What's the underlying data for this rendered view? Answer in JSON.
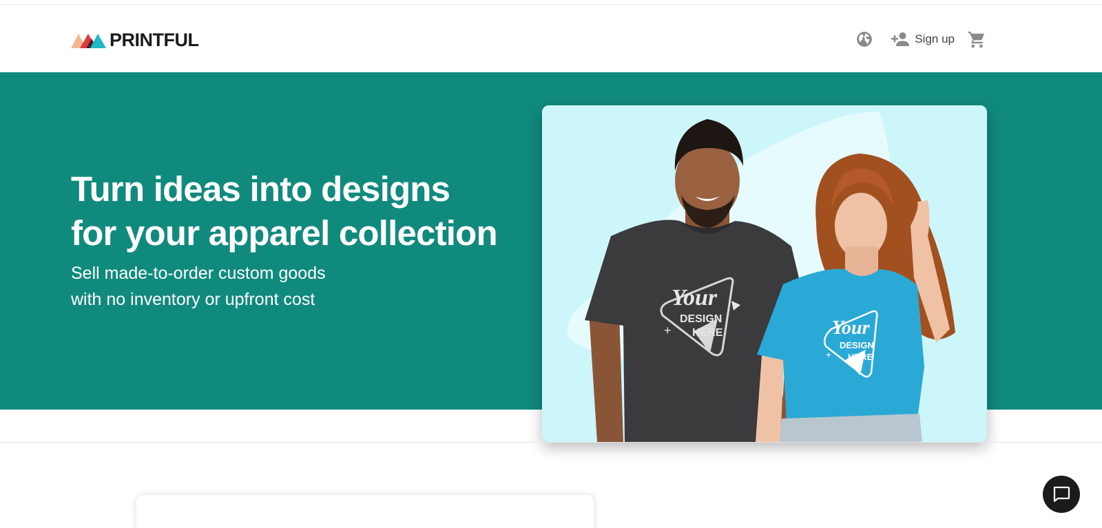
{
  "header": {
    "brand": "PRINTFUL",
    "nav": {
      "language_icon": "globe-icon",
      "signup_icon": "person-add-icon",
      "signup_label": "Sign up",
      "cart_icon": "cart-icon"
    }
  },
  "hero": {
    "title_line1": "Turn ideas into designs",
    "title_line2": "for your apparel collection",
    "subtitle_line1": "Sell made-to-order custom goods",
    "subtitle_line2": "with no inventory or upfront cost",
    "image": {
      "shirt_print_line1": "Your",
      "shirt_print_line2": "DESIGN",
      "shirt_print_line3": "HERE"
    }
  },
  "chat": {
    "icon": "chat-icon"
  },
  "colors": {
    "hero_bg": "#118a7e",
    "image_bg": "#cdf6fb",
    "brand_text": "#1b1b1b",
    "logo_peach": "#f3b793",
    "logo_red": "#e5383b",
    "logo_teal": "#1fb8c6",
    "nav_icon": "#8a8a8a"
  }
}
